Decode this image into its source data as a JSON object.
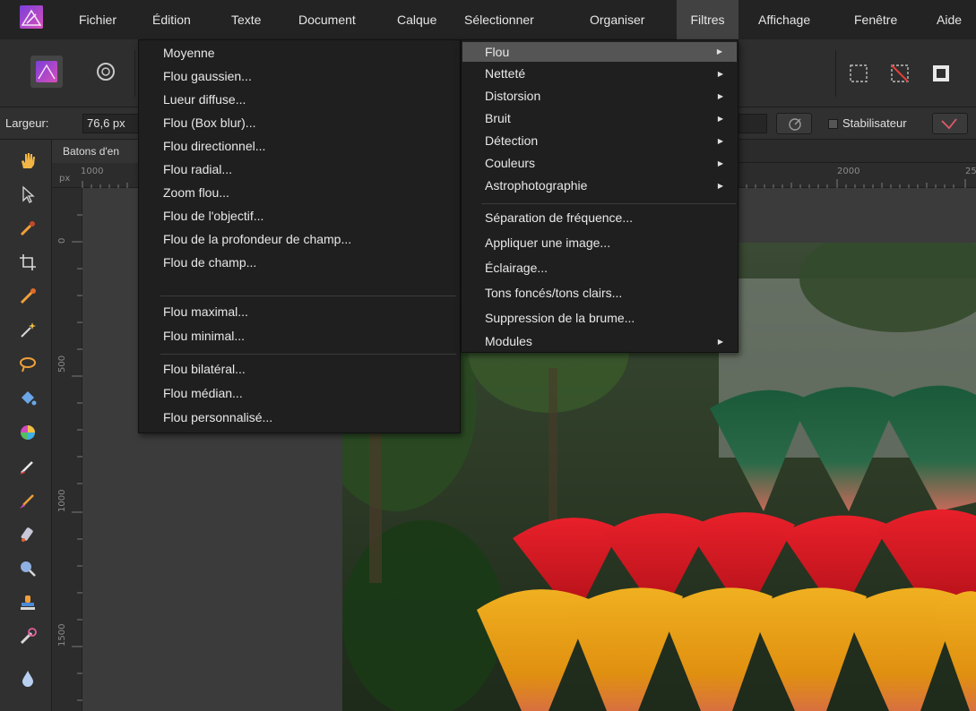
{
  "menubar": {
    "items": [
      "Fichier",
      "Édition",
      "Texte",
      "Document",
      "Calque",
      "Sélectionner",
      "Organiser",
      "Filtres",
      "Affichage",
      "Fenêtre",
      "Aide"
    ],
    "active": "Filtres"
  },
  "context_bar": {
    "width_label": "Largeur:",
    "width_value": "76,6 px",
    "stabilizer_label": "Stabilisateur"
  },
  "document": {
    "tab_title": "Batons d'en"
  },
  "rulers": {
    "unit": "px",
    "h_ticks": [
      "1000",
      "2000",
      "25"
    ],
    "v_ticks": [
      "0",
      "500",
      "1000",
      "1500"
    ]
  },
  "filters_menu": {
    "items": [
      {
        "label": "Flou",
        "submenu": true,
        "highlighted": true
      },
      {
        "label": "Netteté",
        "submenu": true
      },
      {
        "label": "Distorsion",
        "submenu": true
      },
      {
        "label": "Bruit",
        "submenu": true
      },
      {
        "label": "Détection",
        "submenu": true
      },
      {
        "label": "Couleurs",
        "submenu": true
      },
      {
        "label": "Astrophotographie",
        "submenu": true
      },
      {
        "label": "Séparation de fréquence..."
      },
      {
        "label": "Appliquer une image..."
      },
      {
        "label": "Éclairage..."
      },
      {
        "label": "Tons foncés/tons clairs..."
      },
      {
        "label": "Suppression de la brume..."
      },
      {
        "label": "Modules",
        "submenu": true
      }
    ]
  },
  "blur_submenu": {
    "items": [
      "Moyenne",
      "Flou gaussien...",
      "Lueur diffuse...",
      "Flou (Box blur)...",
      "Flou directionnel...",
      "Flou radial...",
      "Zoom flou...",
      "Flou de l'objectif...",
      "Flou de la profondeur de champ...",
      "Flou de champ...",
      "Flou maximal...",
      "Flou minimal...",
      "Flou bilatéral...",
      "Flou médian...",
      "Flou personnalisé..."
    ]
  },
  "icons": {
    "app": "affinity-photo-logo",
    "tools": [
      "hand-icon",
      "move-icon",
      "color-picker-icon",
      "crop-icon",
      "paintbrush-icon",
      "magic-wand-icon",
      "lasso-icon",
      "fill-icon",
      "color-wheel-icon",
      "brush-icon",
      "mixer-brush-icon",
      "clone-icon",
      "zoom-icon",
      "stamp-icon",
      "burn-icon",
      "blur-drop-icon"
    ]
  },
  "colors": {
    "accent": "#b34fd6",
    "menu_bg": "#1f1f1f",
    "highlight": "#555555"
  }
}
